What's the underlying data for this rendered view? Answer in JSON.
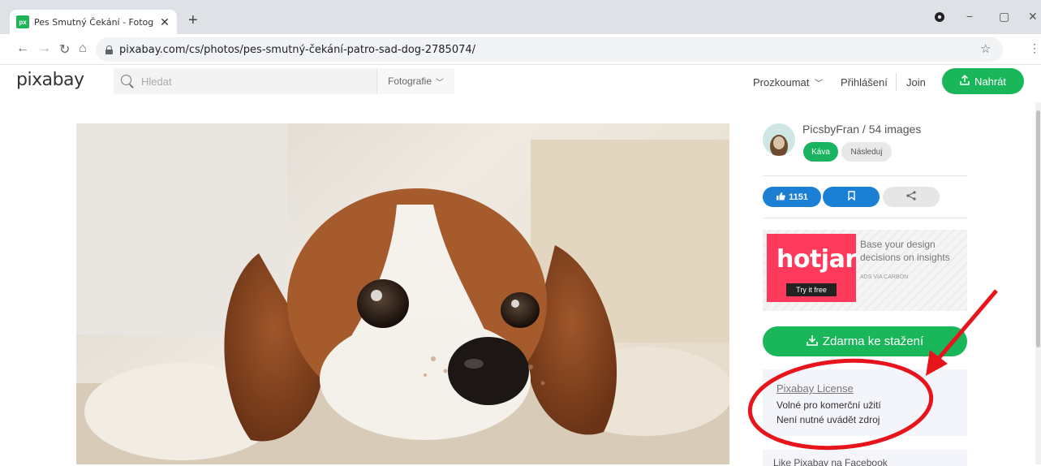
{
  "browser": {
    "tab_title": "Pes Smutný Čekání - Fotografie z",
    "favicon_text": "px",
    "url": "pixabay.com/cs/photos/pes-smutný-čekání-patro-sad-dog-2785074/"
  },
  "header": {
    "logo": "pixabay",
    "search_placeholder": "Hledat",
    "search_type": "Fotografie",
    "explore": "Prozkoumat",
    "login": "Přihlášení",
    "join": "Join",
    "upload": "Nahrát"
  },
  "author": {
    "name_line": "PicsbyFran / 54 images",
    "coffee_button": "Káva",
    "follow_button": "Následuj"
  },
  "actions": {
    "likes": "1151"
  },
  "ad": {
    "brand": "hotjar",
    "cta": "Try it free",
    "text": "Base your design decisions on insights",
    "via": "ADS VIA CARBON"
  },
  "download": {
    "label": "Zdarma ke stažení"
  },
  "license": {
    "title": "Pixabay License",
    "line1": "Volné pro komerční užití",
    "line2": "Není nutné uvádět zdroj"
  },
  "facebook": {
    "text": "Like Pixabay na Facebook"
  },
  "colors": {
    "green": "#19b65a",
    "blue": "#1b7fd4",
    "hotjar": "#fd3a5c",
    "annotation_red": "#e8141c"
  }
}
